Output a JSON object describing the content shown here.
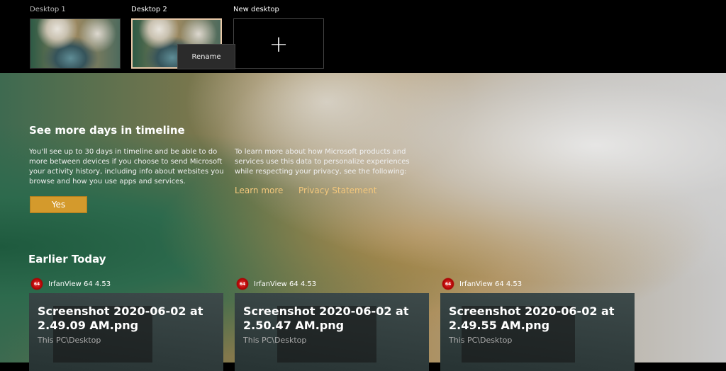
{
  "desktops": [
    {
      "label": "Desktop 1"
    },
    {
      "label": "Desktop 2"
    },
    {
      "label": "New desktop",
      "icon": "plus-icon"
    }
  ],
  "context_menu": {
    "rename": "Rename"
  },
  "promo": {
    "title": "See more days in timeline",
    "left_text": "You'll see up to 30 days in timeline and be able to do more between devices if you choose to send Microsoft your activity history, including info about websites you browse and how you use apps and services.",
    "right_text": "To learn more about how Microsoft products and services use this data to personalize experiences while respecting your privacy, see the following:",
    "learn_more": "Learn more",
    "privacy": "Privacy Statement",
    "yes": "Yes",
    "accent": "#d49a2c"
  },
  "section_title": "Earlier Today",
  "activities": [
    {
      "app": "IrfanView 64 4.53",
      "icon_text": "64",
      "title": "Screenshot 2020-06-02 at 2.49.09 AM.png",
      "path": "This PC\\Desktop"
    },
    {
      "app": "IrfanView 64 4.53",
      "icon_text": "64",
      "title": "Screenshot 2020-06-02 at 2.50.47 AM.png",
      "path": "This PC\\Desktop"
    },
    {
      "app": "IrfanView 64 4.53",
      "icon_text": "64",
      "title": "Screenshot 2020-06-02 at 2.49.55 AM.png",
      "path": "This PC\\Desktop"
    }
  ]
}
